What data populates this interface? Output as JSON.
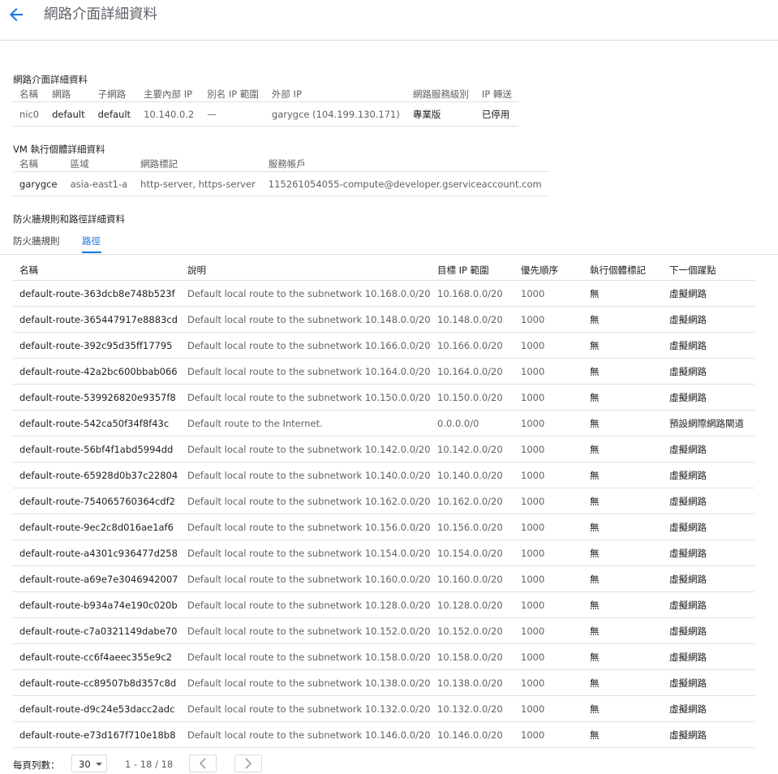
{
  "header": {
    "title": "網路介面詳細資料"
  },
  "nic_section": {
    "title": "網路介面詳細資料",
    "columns": [
      "名稱",
      "網路",
      "子網路",
      "主要內部 IP",
      "別名 IP 範圍",
      "外部 IP",
      "網路服務級別",
      "IP 轉送"
    ],
    "row": [
      "nic0",
      "default",
      "default",
      "10.140.0.2",
      "—",
      "garygce (104.199.130.171)",
      "專業版",
      "已停用"
    ]
  },
  "vm_section": {
    "title": "VM 執行個體詳細資料",
    "columns": [
      "名稱",
      "區域",
      "網路標記",
      "服務帳戶"
    ],
    "row": [
      "garygce",
      "asia-east1-a",
      "http-server, https-server",
      "115261054055-compute@developer.gserviceaccount.com"
    ]
  },
  "fw_section": {
    "title": "防火牆規則和路徑詳細資料",
    "tabs": [
      "防火牆規則",
      "路徑"
    ],
    "active_tab": "路徑"
  },
  "routes": {
    "columns": [
      "名稱",
      "說明",
      "目標 IP 範圍",
      "優先順序",
      "執行個體標記",
      "下一個躍點"
    ],
    "rows": [
      [
        "default-route-363dcb8e748b523f",
        "Default local route to the subnetwork 10.168.0.0/20.",
        "10.168.0.0/20",
        "1000",
        "無",
        "虛擬網路"
      ],
      [
        "default-route-365447917e8883cd",
        "Default local route to the subnetwork 10.148.0.0/20.",
        "10.148.0.0/20",
        "1000",
        "無",
        "虛擬網路"
      ],
      [
        "default-route-392c95d35ff17795",
        "Default local route to the subnetwork 10.166.0.0/20.",
        "10.166.0.0/20",
        "1000",
        "無",
        "虛擬網路"
      ],
      [
        "default-route-42a2bc600bbab066",
        "Default local route to the subnetwork 10.164.0.0/20.",
        "10.164.0.0/20",
        "1000",
        "無",
        "虛擬網路"
      ],
      [
        "default-route-539926820e9357f8",
        "Default local route to the subnetwork 10.150.0.0/20.",
        "10.150.0.0/20",
        "1000",
        "無",
        "虛擬網路"
      ],
      [
        "default-route-542ca50f34f8f43c",
        "Default route to the Internet.",
        "0.0.0.0/0",
        "1000",
        "無",
        "預設網際網路閘道"
      ],
      [
        "default-route-56bf4f1abd5994dd",
        "Default local route to the subnetwork 10.142.0.0/20.",
        "10.142.0.0/20",
        "1000",
        "無",
        "虛擬網路"
      ],
      [
        "default-route-65928d0b37c22804",
        "Default local route to the subnetwork 10.140.0.0/20.",
        "10.140.0.0/20",
        "1000",
        "無",
        "虛擬網路"
      ],
      [
        "default-route-754065760364cdf2",
        "Default local route to the subnetwork 10.162.0.0/20.",
        "10.162.0.0/20",
        "1000",
        "無",
        "虛擬網路"
      ],
      [
        "default-route-9ec2c8d016ae1af6",
        "Default local route to the subnetwork 10.156.0.0/20.",
        "10.156.0.0/20",
        "1000",
        "無",
        "虛擬網路"
      ],
      [
        "default-route-a4301c936477d258",
        "Default local route to the subnetwork 10.154.0.0/20.",
        "10.154.0.0/20",
        "1000",
        "無",
        "虛擬網路"
      ],
      [
        "default-route-a69e7e3046942007",
        "Default local route to the subnetwork 10.160.0.0/20.",
        "10.160.0.0/20",
        "1000",
        "無",
        "虛擬網路"
      ],
      [
        "default-route-b934a74e190c020b",
        "Default local route to the subnetwork 10.128.0.0/20.",
        "10.128.0.0/20",
        "1000",
        "無",
        "虛擬網路"
      ],
      [
        "default-route-c7a0321149dabe70",
        "Default local route to the subnetwork 10.152.0.0/20.",
        "10.152.0.0/20",
        "1000",
        "無",
        "虛擬網路"
      ],
      [
        "default-route-cc6f4aeec355e9c2",
        "Default local route to the subnetwork 10.158.0.0/20.",
        "10.158.0.0/20",
        "1000",
        "無",
        "虛擬網路"
      ],
      [
        "default-route-cc89507b8d357c8d",
        "Default local route to the subnetwork 10.138.0.0/20.",
        "10.138.0.0/20",
        "1000",
        "無",
        "虛擬網路"
      ],
      [
        "default-route-d9c24e53dacc2adc",
        "Default local route to the subnetwork 10.132.0.0/20.",
        "10.132.0.0/20",
        "1000",
        "無",
        "虛擬網路"
      ],
      [
        "default-route-e73d167f710e18b8",
        "Default local route to the subnetwork 10.146.0.0/20.",
        "10.146.0.0/20",
        "1000",
        "無",
        "虛擬網路"
      ]
    ]
  },
  "pagination": {
    "rows_per_page_label": "每頁列數：",
    "rows_per_page": "30",
    "range": "1 - 18 / 18"
  },
  "colors": {
    "accent": "#1a73e8",
    "divider": "#e0e0e0",
    "muted_text": "#616161"
  },
  "icons": {
    "back": "arrow-back-icon",
    "prev": "chevron-left-icon",
    "next": "chevron-right-icon",
    "dropdown": "triangle-down-icon"
  }
}
